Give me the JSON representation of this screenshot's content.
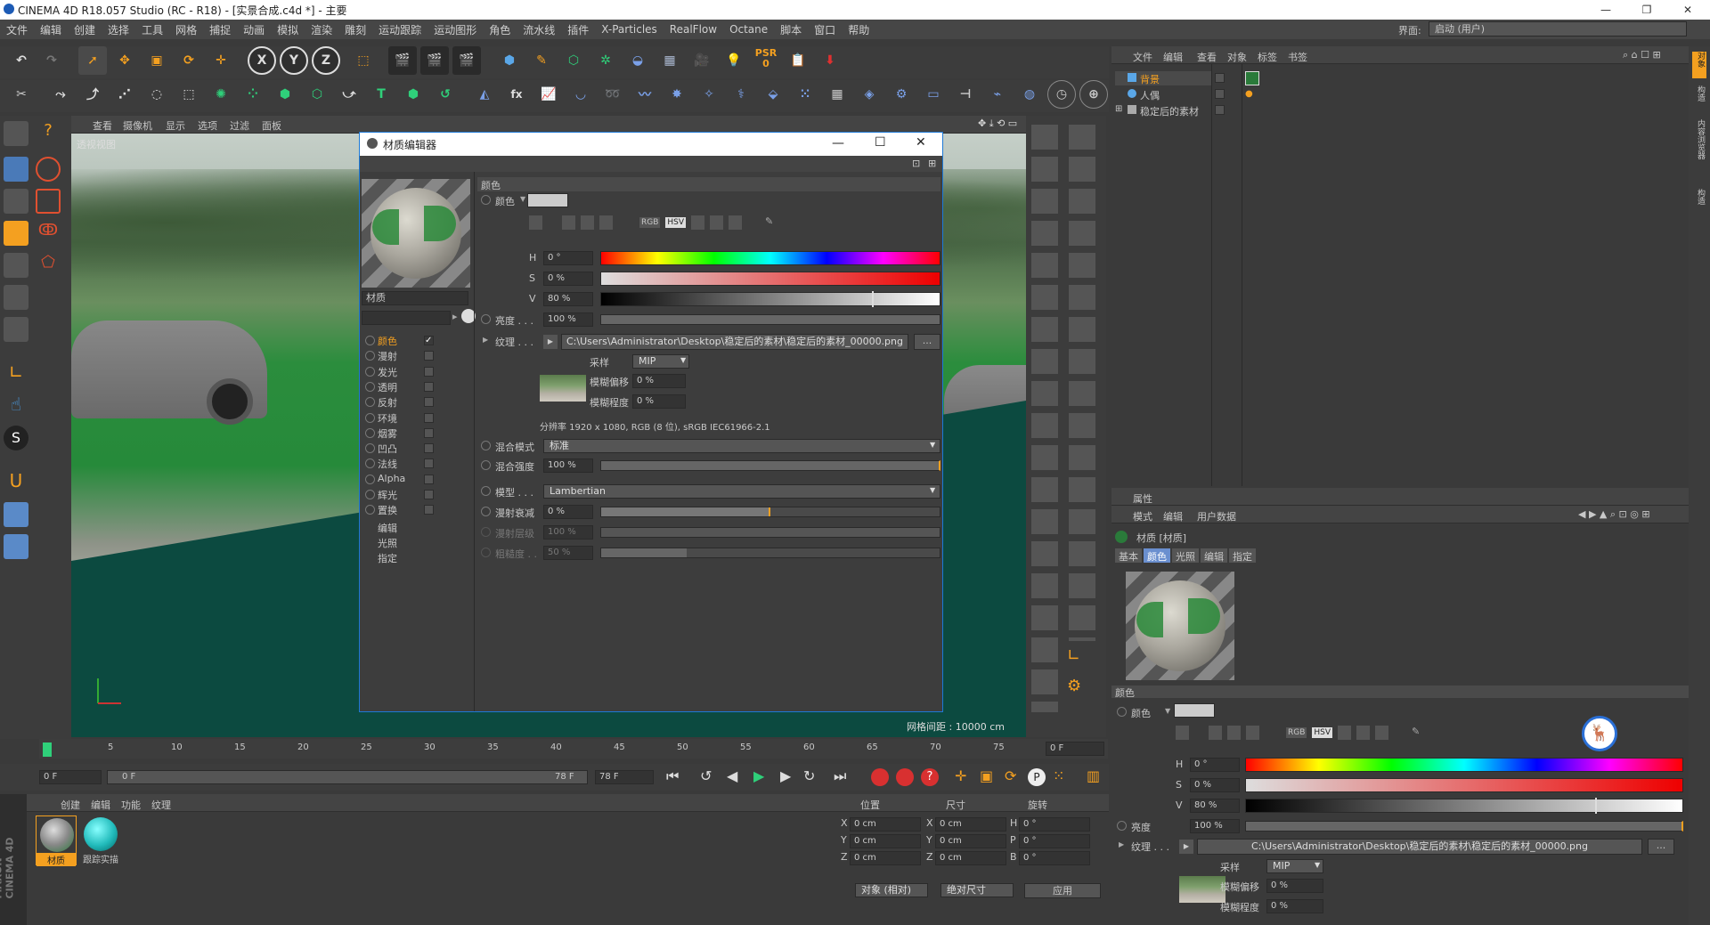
{
  "window": {
    "title": "CINEMA 4D R18.057 Studio (RC - R18) - [实景合成.c4d *] - 主要",
    "min": "—",
    "restore": "❐",
    "close": "✕"
  },
  "menu": [
    "文件",
    "编辑",
    "创建",
    "选择",
    "工具",
    "网格",
    "捕捉",
    "动画",
    "模拟",
    "渲染",
    "雕刻",
    "运动跟踪",
    "运动图形",
    "角色",
    "流水线",
    "插件",
    "X-Particles",
    "RealFlow",
    "Octane",
    "脚本",
    "窗口",
    "帮助"
  ],
  "layout": {
    "label": "界面:",
    "value": "启动 (用户)"
  },
  "viewport": {
    "menu": [
      "查看",
      "摄像机",
      "显示",
      "选项",
      "过滤",
      "面板"
    ],
    "label": "透视视图",
    "grid_info": "网格间距 : 10000 cm"
  },
  "toolbar_letters": {
    "x": "X",
    "y": "Y",
    "z": "Z",
    "psr": "PSR",
    "psr_val": "0"
  },
  "mat_editor": {
    "title": "材质编辑器",
    "name": "材质",
    "channels": [
      {
        "label": "颜色",
        "checked": true,
        "active": true
      },
      {
        "label": "漫射",
        "checked": false
      },
      {
        "label": "发光",
        "checked": false
      },
      {
        "label": "透明",
        "checked": false
      },
      {
        "label": "反射",
        "checked": false
      },
      {
        "label": "环境",
        "checked": false
      },
      {
        "label": "烟雾",
        "checked": false
      },
      {
        "label": "凹凸",
        "checked": false
      },
      {
        "label": "法线",
        "checked": false
      },
      {
        "label": "Alpha",
        "checked": false
      },
      {
        "label": "辉光",
        "checked": false
      },
      {
        "label": "置换",
        "checked": false
      }
    ],
    "extra": [
      "编辑",
      "光照",
      "指定"
    ],
    "section": "颜色",
    "color_label": "颜色",
    "h_label": "H",
    "h_val": "0 °",
    "s_label": "S",
    "s_val": "0 %",
    "v_label": "V",
    "v_val": "80 %",
    "v_level": 0.8,
    "rgb": "RGB",
    "hsv": "HSV",
    "brightness_label": "亮度 . . .",
    "brightness_val": "100 %",
    "texture_label": "纹理 . . .",
    "texture_path": "C:\\Users\\Administrator\\Desktop\\稳定后的素材\\稳定后的素材_00000.png",
    "browse": "...",
    "sample_label": "采样",
    "sample_val": "MIP",
    "blur_offset_label": "模糊偏移",
    "blur_offset_val": "0 %",
    "blur_scale_label": "模糊程度",
    "blur_scale_val": "0 %",
    "resolution": "分辨率 1920 x 1080, RGB (8 位), sRGB IEC61966-2.1",
    "mix_mode_label": "混合模式",
    "mix_mode_val": "标准",
    "mix_strength_label": "混合强度",
    "mix_strength_val": "100 %",
    "model_label": "模型 . . .",
    "model_val": "Lambertian",
    "diffuse_falloff_label": "漫射衰减",
    "diffuse_falloff_val": "0 %",
    "diffuse_falloff_level": 0.5,
    "diffuse_level_label": "漫射层级",
    "diffuse_level_val": "100 %",
    "roughness_label": "粗糙度 . .",
    "roughness_val": "50 %"
  },
  "timeline": {
    "ticks": [
      "0",
      "5",
      "10",
      "15",
      "20",
      "25",
      "30",
      "35",
      "40",
      "45",
      "50",
      "55",
      "60",
      "65",
      "70",
      "75"
    ],
    "frame_right": "0 F",
    "start": "0 F",
    "cur": "0 F",
    "end_in": "78 F",
    "end": "78 F"
  },
  "materials": {
    "menu": [
      "创建",
      "编辑",
      "功能",
      "纹理"
    ],
    "items": [
      {
        "label": "材质"
      },
      {
        "label": "跟踪实描"
      }
    ]
  },
  "coords": {
    "heads": [
      "位置",
      "尺寸",
      "旋转"
    ],
    "rows": [
      {
        "a": "X",
        "av": "0 cm",
        "b": "X",
        "bv": "0 cm",
        "c": "H",
        "cv": "0 °"
      },
      {
        "a": "Y",
        "av": "0 cm",
        "b": "Y",
        "bv": "0 cm",
        "c": "P",
        "cv": "0 °"
      },
      {
        "a": "Z",
        "av": "0 cm",
        "b": "Z",
        "bv": "0 cm",
        "c": "B",
        "cv": "0 °"
      }
    ],
    "mode1": "对象 (相对)",
    "mode2": "绝对尺寸",
    "apply": "应用"
  },
  "objects": {
    "menu": [
      "文件",
      "编辑",
      "查看",
      "对象",
      "标签",
      "书签"
    ],
    "items": [
      {
        "label": "背景"
      },
      {
        "label": "人偶"
      },
      {
        "label": "稳定后的素材"
      }
    ]
  },
  "attributes": {
    "title": "属性",
    "menu": [
      "模式",
      "编辑",
      "用户数据"
    ],
    "obj": "材质 [材质]",
    "tabs": [
      "基本",
      "颜色",
      "光照",
      "编辑",
      "指定"
    ],
    "active_tab": "颜色",
    "section": "颜色",
    "color_label": "颜色",
    "h_label": "H",
    "h_val": "0 °",
    "s_label": "S",
    "s_val": "0 %",
    "v_label": "V",
    "v_val": "80 %",
    "brightness_label": "亮度",
    "brightness_val": "100 %",
    "texture_label": "纹理 . . .",
    "texture_path": "C:\\Users\\Administrator\\Desktop\\稳定后的素材\\稳定后的素材_00000.png",
    "sample_label": "采样",
    "sample_val": "MIP",
    "blur_offset_label": "模糊偏移",
    "blur_offset_val": "0 %",
    "blur_scale_label": "模糊程度",
    "blur_scale_val": "0 %"
  },
  "right_tabs": [
    "对象",
    "构造",
    "内容浏览器",
    "构造"
  ],
  "maxon": "MAXON\nCINEMA 4D"
}
